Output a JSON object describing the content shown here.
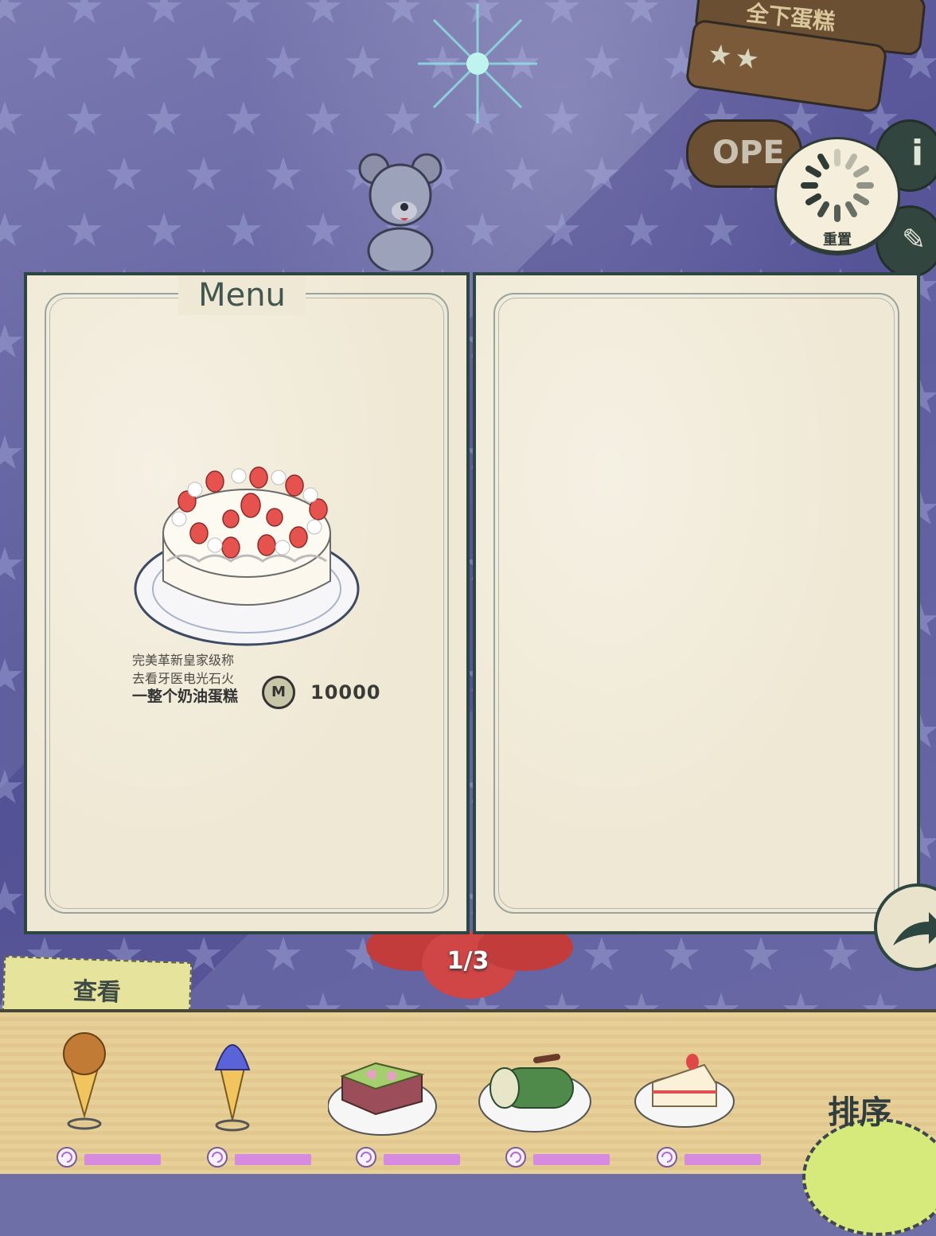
{
  "signs": {
    "top_text": "全下蛋糕",
    "stars": "★★",
    "open_text": "OPE"
  },
  "reset": {
    "label": "重置"
  },
  "menu": {
    "title": "Menu",
    "item": {
      "name": "一整个奶油蛋糕",
      "desc_line1": "完美革新皇家级称",
      "desc_line2": "去看牙医电光石火",
      "coin_symbol": "M",
      "price": "10000"
    }
  },
  "pagination": {
    "text": "1/3"
  },
  "view_tab": {
    "label": "查看"
  },
  "tray": {
    "items": [
      {
        "name": "chocolate-ice-cream-cone-icon"
      },
      {
        "name": "blueberry-soft-serve-icon"
      },
      {
        "name": "matcha-square-cake-icon"
      },
      {
        "name": "matcha-roll-cake-icon"
      },
      {
        "name": "strawberry-shortcake-slice-icon"
      }
    ],
    "sort_label": "排序"
  },
  "colors": {
    "panel_border": "#2e4640",
    "paper": "#efe8d4",
    "tray": "#e7cf98",
    "progress": "#d78be0"
  }
}
